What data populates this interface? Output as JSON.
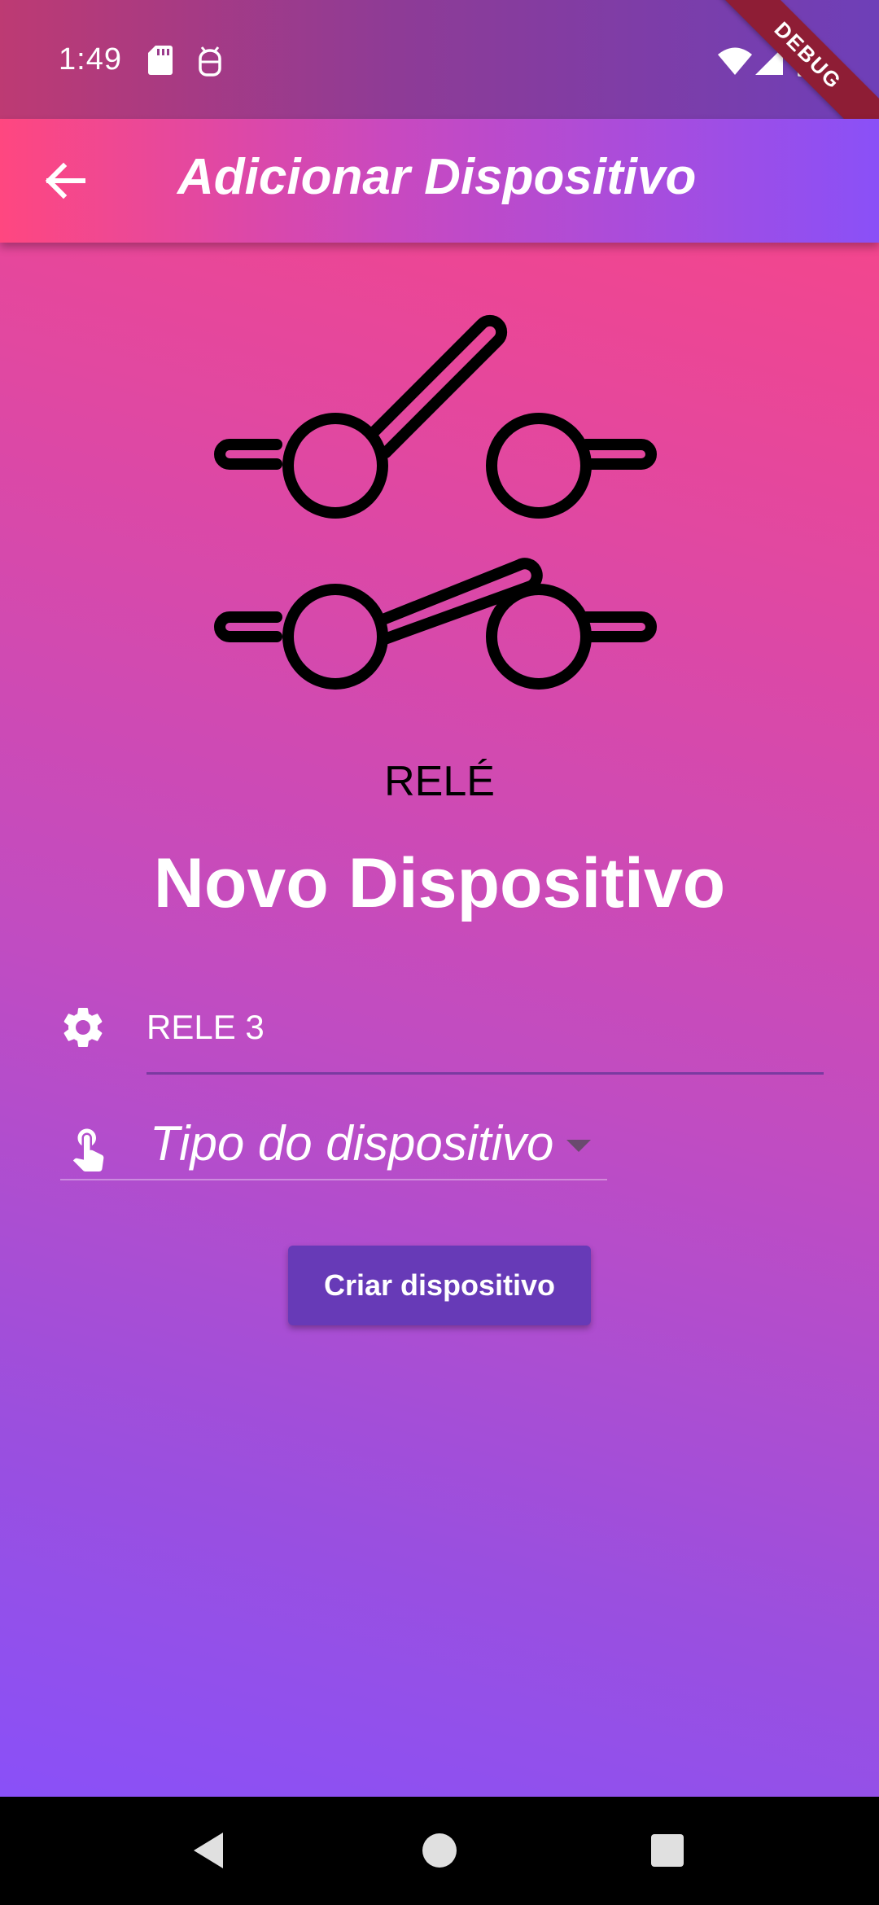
{
  "status_bar": {
    "time": "1:49",
    "icons": [
      "sd-card-icon",
      "android-debug-icon",
      "wifi-icon",
      "signal-icon",
      "battery-icon"
    ],
    "debug_banner": "DEBUG"
  },
  "app_bar": {
    "back_icon": "arrow-back-icon",
    "title": "Adicionar Dispositivo"
  },
  "illustration": {
    "icon": "relay-switch-icon",
    "label": "RELÉ"
  },
  "form": {
    "heading": "Novo Dispositivo",
    "name_field": {
      "icon": "gear-icon",
      "value": "RELE 3",
      "placeholder": ""
    },
    "type_dropdown": {
      "icon": "touch-app-icon",
      "hint": "Tipo do dispositivo",
      "arrow_icon": "dropdown-arrow-icon"
    },
    "submit_label": "Criar dispositivo"
  },
  "nav_bar": {
    "icons": [
      "nav-back-icon",
      "nav-home-icon",
      "nav-recents-icon"
    ]
  },
  "colors": {
    "gradient_top": "#ff4480",
    "gradient_bottom": "#8551ff",
    "button": "#673ab7",
    "underline": "#7a3aa0",
    "debug_ribbon": "#8e1d35"
  }
}
